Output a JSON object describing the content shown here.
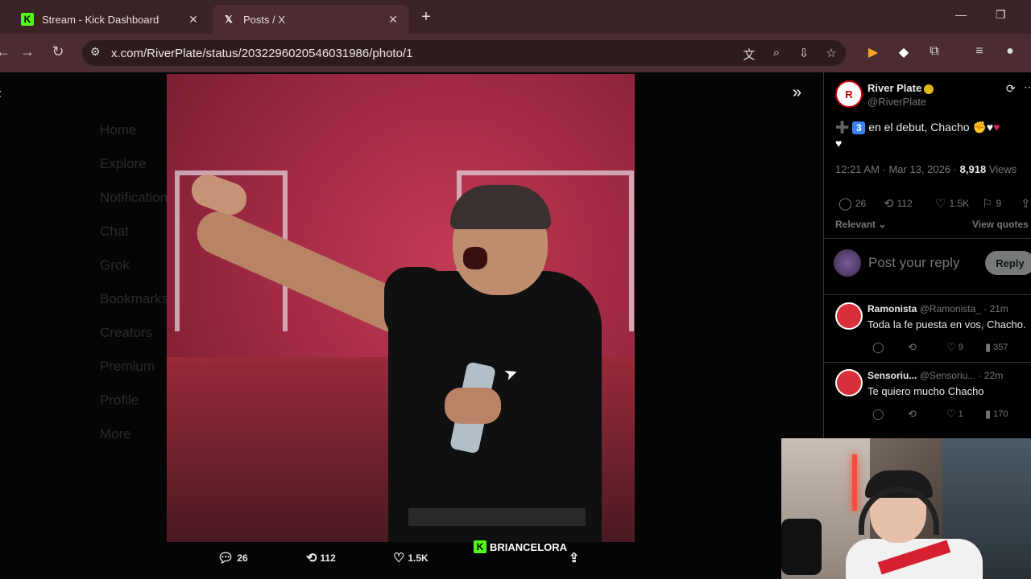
{
  "browser": {
    "tabs": [
      {
        "title": "Stream - Kick Dashboard",
        "favicon": "kick-icon",
        "active": false
      },
      {
        "title": "Posts / X",
        "favicon": "x-logo-icon",
        "active": true
      }
    ],
    "url": "x.com/RiverPlate/status/2032296020546031986/photo/1"
  },
  "background_nav": [
    "Home",
    "Explore",
    "Notifications",
    "Chat",
    "Grok",
    "Bookmarks",
    "Creators",
    "Premium",
    "Profile",
    "More"
  ],
  "photo_actions": {
    "replies": "26",
    "reposts": "112",
    "likes": "1.5K"
  },
  "watermark": "BRIANCELORA",
  "post": {
    "author_name": "River Plate",
    "author_handle": "@RiverPlate",
    "text_number": "3",
    "text": "en el debut, Chacho",
    "time": "12:21 AM · Mar 13, 2026 · ",
    "views_count": "8,918",
    "views_label": " Views",
    "stats": {
      "replies": "26",
      "reposts": "112",
      "likes": "1.5K",
      "bookmarks": "9"
    },
    "sort_label": "Relevant",
    "view_quotes": "View quotes"
  },
  "reply_box": {
    "placeholder": "Post your reply",
    "button": "Reply"
  },
  "replies": [
    {
      "name": "Ramonista",
      "handle": "@Ramonista_ · 21m",
      "text": "Toda la fe puesta en vos, Chacho.",
      "likes": "9",
      "views": "357"
    },
    {
      "name": "Sensoriu...",
      "handle": "@Sensoriu... · 22m",
      "text": "Te quiero mucho  Chacho",
      "likes": "1",
      "views": "170"
    }
  ],
  "colors": {
    "accent": "#53fc18",
    "tab_bar": "#3a2226",
    "verified": "#e2b719"
  }
}
